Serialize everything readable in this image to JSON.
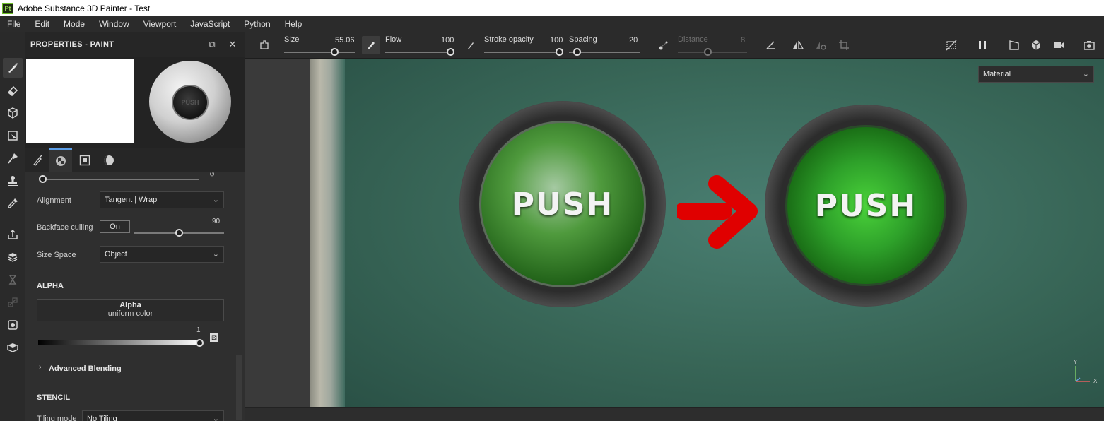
{
  "window": {
    "title": "Adobe Substance 3D Painter - Test",
    "app_badge": "Pt"
  },
  "menu": [
    "File",
    "Edit",
    "Mode",
    "Window",
    "Viewport",
    "JavaScript",
    "Python",
    "Help"
  ],
  "panel": {
    "title": "PROPERTIES - PAINT",
    "sphere_label": "PUSH",
    "alignment": {
      "label": "Alignment",
      "value": "Tangent | Wrap"
    },
    "backface": {
      "label": "Backface culling",
      "button": "On",
      "value": "90"
    },
    "size_space": {
      "label": "Size Space",
      "value": "Object"
    },
    "alpha": {
      "section": "ALPHA",
      "name": "Alpha",
      "sub": "uniform color",
      "value": "1"
    },
    "advanced": "Advanced Blending",
    "stencil": {
      "section": "STENCIL",
      "tiling_label": "Tiling mode",
      "tiling_value": "No Tiling"
    }
  },
  "toolbar": {
    "size": {
      "label": "Size",
      "value": "55.06"
    },
    "flow": {
      "label": "Flow",
      "value": "100"
    },
    "stroke_opacity": {
      "label": "Stroke opacity",
      "value": "100"
    },
    "spacing": {
      "label": "Spacing",
      "value": "20"
    },
    "distance": {
      "label": "Distance",
      "value": "8"
    }
  },
  "viewport": {
    "mode_dropdown": "Material",
    "button_left_text": "PUSH",
    "button_right_text": "PUSH",
    "axis_y": "Y",
    "axis_x": "X"
  },
  "colors": {
    "accent": "#5b9ee8",
    "arrow": "#e00000",
    "scene": "#386657"
  }
}
